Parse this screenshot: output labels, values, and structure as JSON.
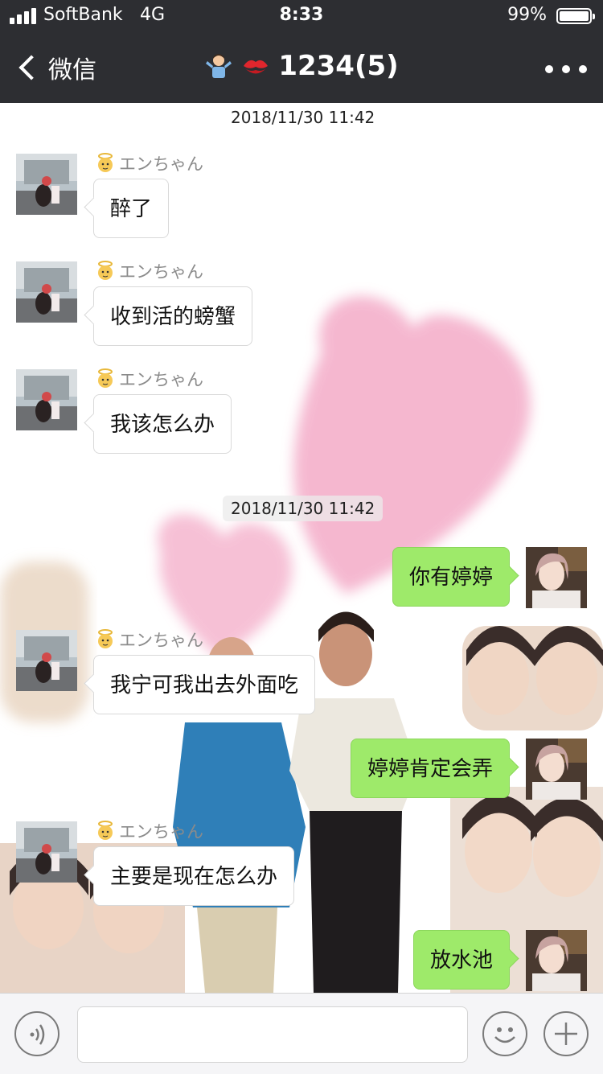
{
  "status_bar": {
    "carrier": "SoftBank",
    "network": "4G",
    "time": "8:33",
    "battery": "99%",
    "battery_level": 0.99
  },
  "nav": {
    "back_label": "微信",
    "title": "1234(5)",
    "title_emoji_icons": [
      "man-shrugging-emoji",
      "kiss-mark-emoji"
    ]
  },
  "colors": {
    "nav_bg": "#2d2e32",
    "outgoing_bubble": "#9eea6a",
    "incoming_bubble": "#ffffff",
    "heart_pink": "#f2a3c2"
  },
  "chat": {
    "timestamps": [
      "2018/11/30 11:42",
      "2018/11/30 11:42"
    ],
    "messages": [
      {
        "direction": "in",
        "sender": "エンちゃん",
        "text": "醉了"
      },
      {
        "direction": "in",
        "sender": "エンちゃん",
        "text": "收到活的螃蟹"
      },
      {
        "direction": "in",
        "sender": "エンちゃん",
        "text": "我该怎么办"
      },
      {
        "direction": "out",
        "text": "你有婷婷"
      },
      {
        "direction": "in",
        "sender": "エンちゃん",
        "text": "我宁可我出去外面吃"
      },
      {
        "direction": "out",
        "text": "婷婷肯定会弄"
      },
      {
        "direction": "in",
        "sender": "エンちゃん",
        "text": "主要是现在怎么办"
      },
      {
        "direction": "out",
        "text": "放水池"
      }
    ]
  },
  "input_bar": {
    "text_value": "",
    "icons": [
      "voice-icon",
      "emoji-icon",
      "plus-icon"
    ]
  }
}
